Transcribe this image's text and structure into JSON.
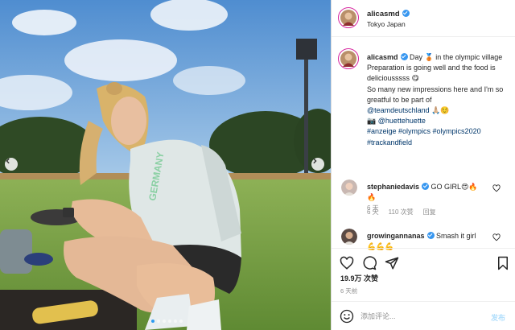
{
  "post": {
    "username": "alicasmd",
    "location": "Tokyo Japan",
    "caption": {
      "author": "alicasmd",
      "line1": "Day 🥉 in the olympic village",
      "line2": "Preparation is going well and the food is deliciousssss 😋",
      "line3": "So many new impressions here and I'm so greatful to be part of",
      "mention": "@teamdeutschland",
      "mention_suffix": " 🙏🏼☺️",
      "camera": "📷",
      "credit": "@huettehuette",
      "tags_line1": "#anzeige #olympics #olympics2020",
      "tags_line2": "#trackandfield",
      "time": "6 天"
    },
    "comments": [
      {
        "username": "stephaniedavis",
        "text": "GO GIRL😍🔥",
        "text2": "🔥",
        "time": "6 天",
        "likes": "110 次赞",
        "reply": "回复"
      },
      {
        "username": "growingannanas",
        "text": "Smash it girl",
        "text2": "💪💪💪"
      }
    ],
    "likes": "19.9万 次赞",
    "date": "6 天前",
    "add_comment_placeholder": "添加评论...",
    "post_button": "发布",
    "carousel": {
      "slides": 6,
      "active_index": 0
    }
  },
  "colors": {
    "verified": "#3897f0",
    "link": "#00376b",
    "muted": "#8e8e8e",
    "post_button": "#b2dffc",
    "carousel_active": "#2d9bf0"
  },
  "icons": [
    "verified-badge",
    "heart-icon",
    "comment-icon",
    "share-icon",
    "bookmark-icon",
    "emoji-icon",
    "chevron-left-icon",
    "chevron-right-icon"
  ]
}
